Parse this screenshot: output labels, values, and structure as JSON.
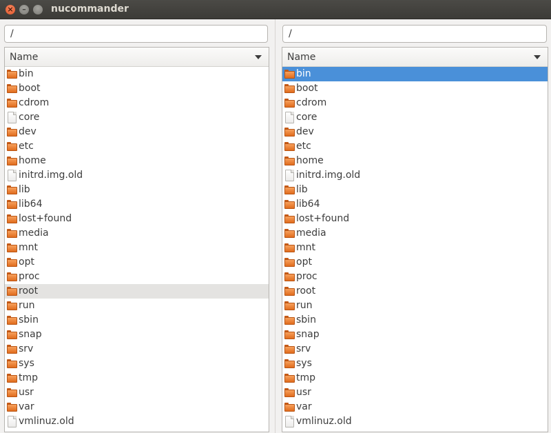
{
  "window": {
    "title": "nucommander"
  },
  "left": {
    "path": "/",
    "column_header": "Name",
    "hover_index": 15,
    "items": [
      {
        "name": "bin",
        "type": "folder"
      },
      {
        "name": "boot",
        "type": "folder"
      },
      {
        "name": "cdrom",
        "type": "folder"
      },
      {
        "name": "core",
        "type": "file"
      },
      {
        "name": "dev",
        "type": "folder"
      },
      {
        "name": "etc",
        "type": "folder"
      },
      {
        "name": "home",
        "type": "folder"
      },
      {
        "name": "initrd.img.old",
        "type": "file"
      },
      {
        "name": "lib",
        "type": "folder"
      },
      {
        "name": "lib64",
        "type": "folder"
      },
      {
        "name": "lost+found",
        "type": "folder"
      },
      {
        "name": "media",
        "type": "folder"
      },
      {
        "name": "mnt",
        "type": "folder"
      },
      {
        "name": "opt",
        "type": "folder"
      },
      {
        "name": "proc",
        "type": "folder"
      },
      {
        "name": "root",
        "type": "folder"
      },
      {
        "name": "run",
        "type": "folder"
      },
      {
        "name": "sbin",
        "type": "folder"
      },
      {
        "name": "snap",
        "type": "folder"
      },
      {
        "name": "srv",
        "type": "folder"
      },
      {
        "name": "sys",
        "type": "folder"
      },
      {
        "name": "tmp",
        "type": "folder"
      },
      {
        "name": "usr",
        "type": "folder"
      },
      {
        "name": "var",
        "type": "folder"
      },
      {
        "name": "vmlinuz.old",
        "type": "file"
      }
    ]
  },
  "right": {
    "path": "/",
    "column_header": "Name",
    "selected_index": 0,
    "items": [
      {
        "name": "bin",
        "type": "folder"
      },
      {
        "name": "boot",
        "type": "folder"
      },
      {
        "name": "cdrom",
        "type": "folder"
      },
      {
        "name": "core",
        "type": "file"
      },
      {
        "name": "dev",
        "type": "folder"
      },
      {
        "name": "etc",
        "type": "folder"
      },
      {
        "name": "home",
        "type": "folder"
      },
      {
        "name": "initrd.img.old",
        "type": "file"
      },
      {
        "name": "lib",
        "type": "folder"
      },
      {
        "name": "lib64",
        "type": "folder"
      },
      {
        "name": "lost+found",
        "type": "folder"
      },
      {
        "name": "media",
        "type": "folder"
      },
      {
        "name": "mnt",
        "type": "folder"
      },
      {
        "name": "opt",
        "type": "folder"
      },
      {
        "name": "proc",
        "type": "folder"
      },
      {
        "name": "root",
        "type": "folder"
      },
      {
        "name": "run",
        "type": "folder"
      },
      {
        "name": "sbin",
        "type": "folder"
      },
      {
        "name": "snap",
        "type": "folder"
      },
      {
        "name": "srv",
        "type": "folder"
      },
      {
        "name": "sys",
        "type": "folder"
      },
      {
        "name": "tmp",
        "type": "folder"
      },
      {
        "name": "usr",
        "type": "folder"
      },
      {
        "name": "var",
        "type": "folder"
      },
      {
        "name": "vmlinuz.old",
        "type": "file"
      }
    ]
  },
  "icons": {
    "folder": "folder-icon",
    "file": "file-icon",
    "close": "close-icon",
    "minimize": "minimize-icon",
    "maximize": "maximize-icon",
    "sort": "sort-desc-icon"
  },
  "colors": {
    "selection": "#4a90d9",
    "hover": "#e4e3e1",
    "folder": "#e97d2c",
    "titlebar": "#3c3b37"
  }
}
